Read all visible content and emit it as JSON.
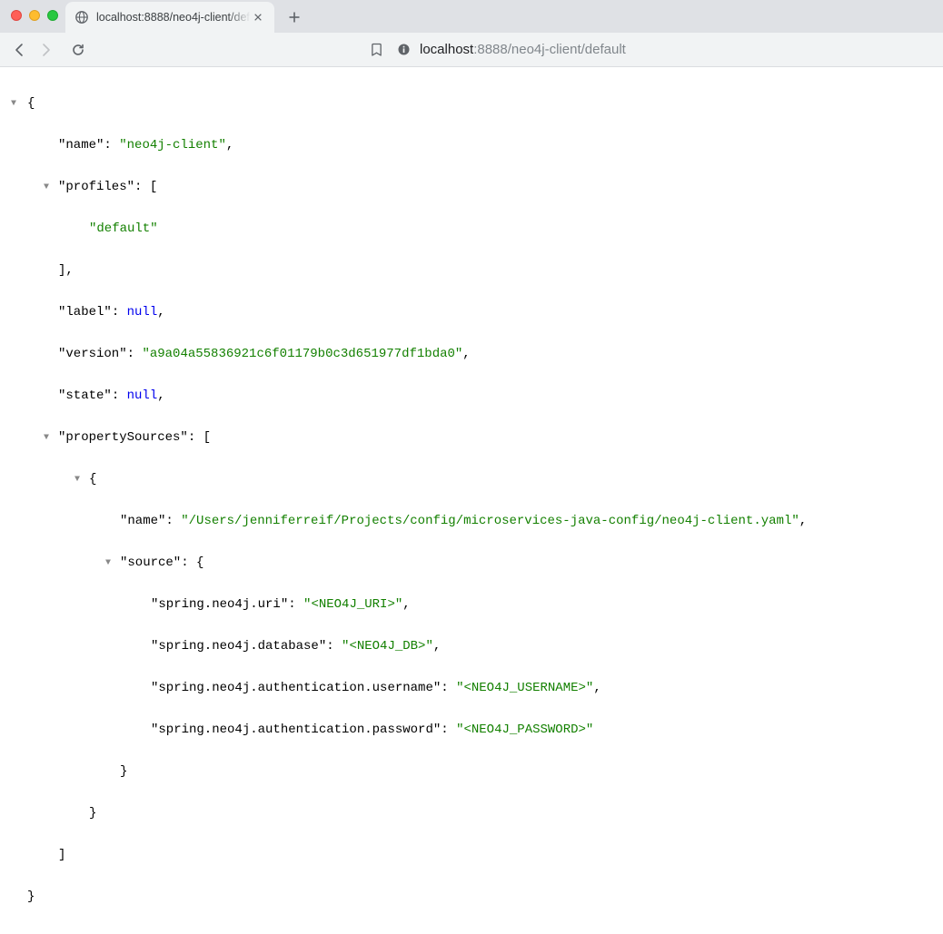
{
  "browser": {
    "tab_title": "localhost:8888/neo4j-client/def",
    "new_tab_label": "+",
    "url_display_host": "localhost",
    "url_display_rest": ":8888/neo4j-client/default"
  },
  "json": {
    "name_key": "\"name\"",
    "name_val": "\"neo4j-client\"",
    "profiles_key": "\"profiles\"",
    "profiles_item0": "\"default\"",
    "label_key": "\"label\"",
    "label_val": "null",
    "version_key": "\"version\"",
    "version_val": "\"a9a04a55836921c6f01179b0c3d651977df1bda0\"",
    "state_key": "\"state\"",
    "state_val": "null",
    "propertySources_key": "\"propertySources\"",
    "ps_name_key": "\"name\"",
    "ps_name_val": "\"/Users/jenniferreif/Projects/config/microservices-java-config/neo4j-client.yaml\"",
    "ps_source_key": "\"source\"",
    "src_uri_key": "\"spring.neo4j.uri\"",
    "src_uri_val": "\"<NEO4J_URI>\"",
    "src_db_key": "\"spring.neo4j.database\"",
    "src_db_val": "\"<NEO4J_DB>\"",
    "src_user_key": "\"spring.neo4j.authentication.username\"",
    "src_user_val": "\"<NEO4J_USERNAME>\"",
    "src_pass_key": "\"spring.neo4j.authentication.password\"",
    "src_pass_val": "\"<NEO4J_PASSWORD>\""
  }
}
